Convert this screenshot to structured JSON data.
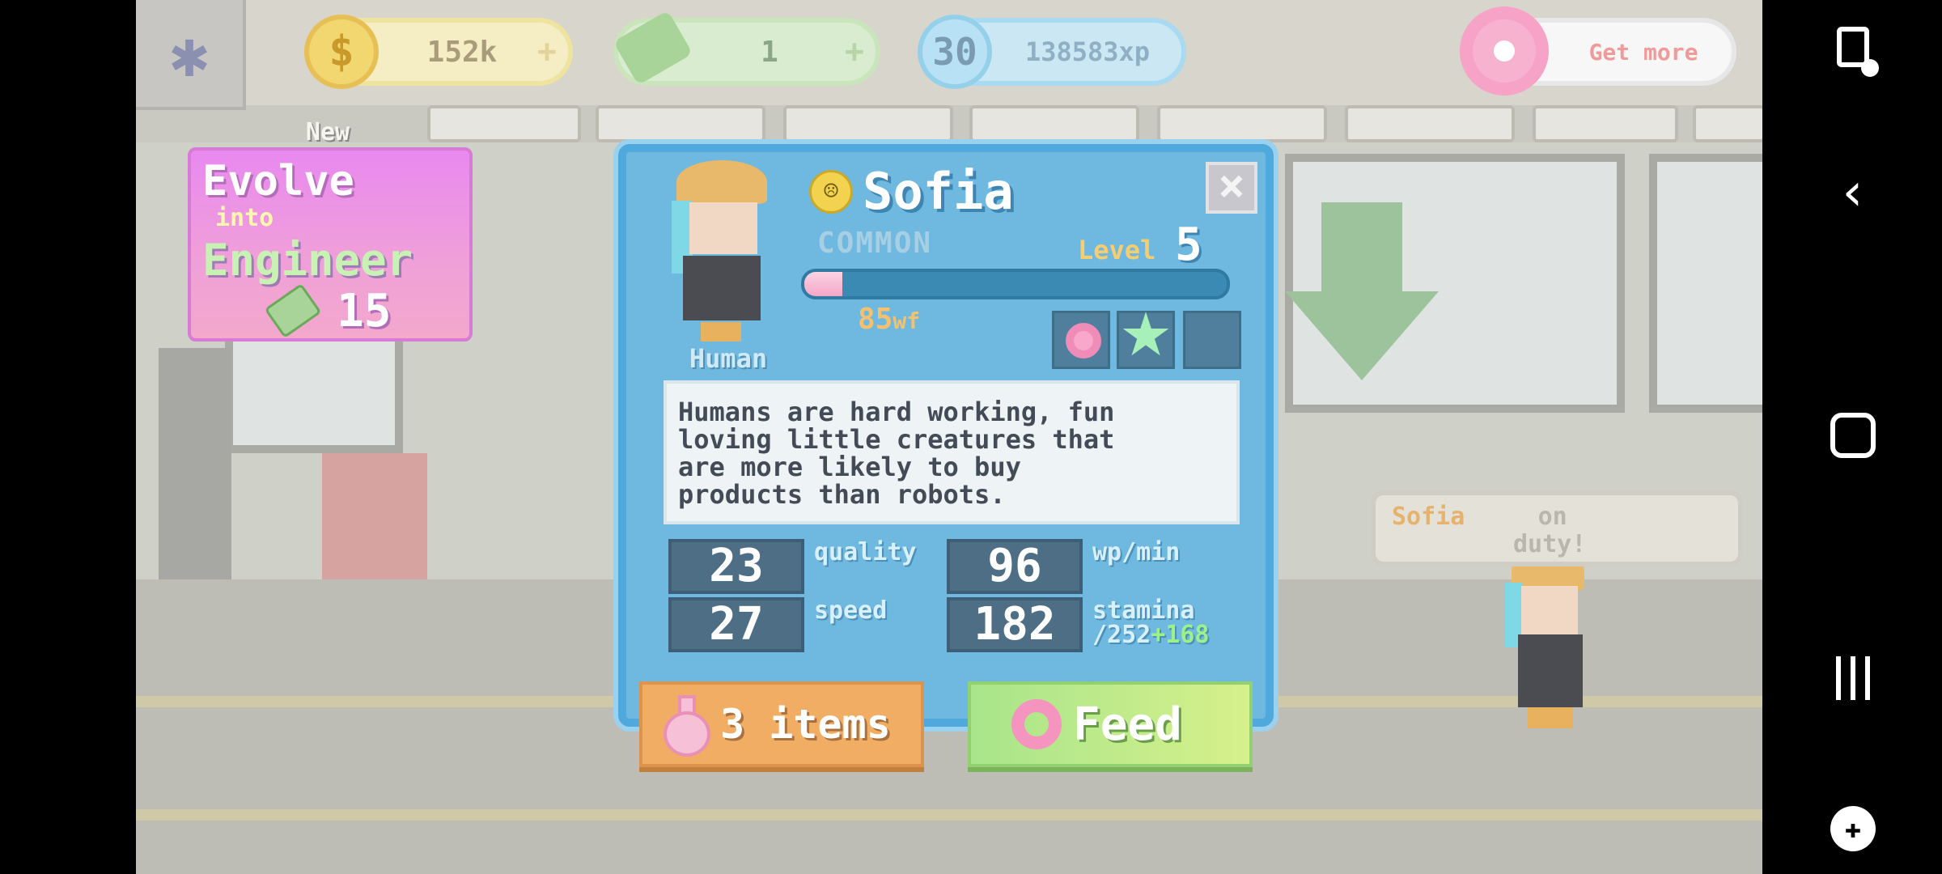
{
  "hud": {
    "coins": {
      "value": "152k",
      "plus": "+",
      "icon": "$"
    },
    "cash": {
      "value": "1",
      "plus": "+"
    },
    "xp": {
      "level": "30",
      "value": "138583xp"
    },
    "donuts": {
      "label": "Get more"
    }
  },
  "evolve": {
    "badge": "New",
    "line1": "Evolve",
    "line2": "into",
    "target": "Engineer",
    "cost": "15"
  },
  "bubble": {
    "name": "Sofia",
    "text": "on",
    "text2": "duty!"
  },
  "modal": {
    "close": "×",
    "name": "Sofia",
    "mood_icon": "sad-face-icon",
    "mood_glyph": "☹",
    "rarity": "COMMON",
    "level_label": "Level",
    "level": "5",
    "species": "Human",
    "wf_value": "85",
    "wf_unit": "wf",
    "wf_fraction": 0.09,
    "description": "Humans are hard working, fun\nloving little creatures that\nare more likely to buy\nproducts than robots.",
    "stats": {
      "quality": {
        "value": "23",
        "label": "quality"
      },
      "wp_min": {
        "value": "96",
        "label": "wp/min"
      },
      "speed": {
        "value": "27",
        "label": "speed"
      },
      "stamina": {
        "value": "182",
        "label": "stamina",
        "max": "/252",
        "bonus": "+168"
      }
    },
    "items_button": "3 items",
    "feed_button": "Feed"
  },
  "colors": {
    "modal_bg": "#6fb8e0",
    "feed_green": "#a8e58b",
    "items_orange": "#f2ad65",
    "evolve_pink": "#e889f0"
  }
}
